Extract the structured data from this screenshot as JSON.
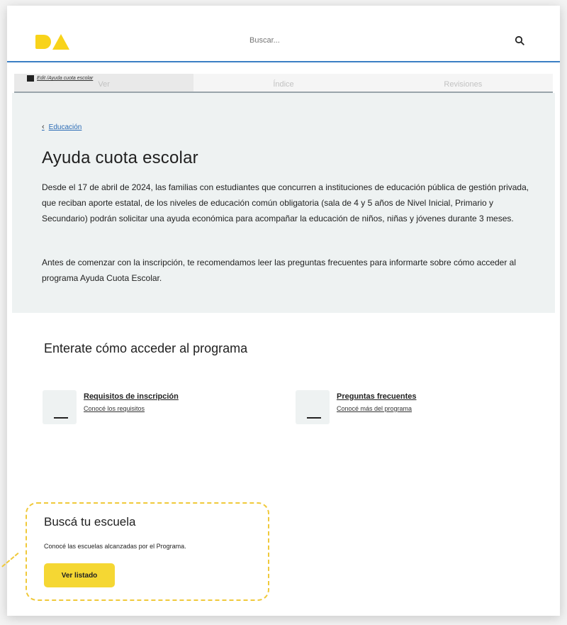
{
  "header": {
    "logo_text": "BA",
    "search": {
      "placeholder": "Buscar...",
      "icon": "search-icon"
    }
  },
  "edit_label": "Edit /Ayuda cuota escolar",
  "tabs": [
    {
      "label": "Ver",
      "active": true
    },
    {
      "label": "Índice",
      "active": false
    },
    {
      "label": "Revisiones",
      "active": false
    }
  ],
  "breadcrumb": {
    "back_icon": "chevron-left-icon",
    "label": "Educación"
  },
  "hero": {
    "title": "Ayuda cuota escolar",
    "paragraph1": "Desde el 17 de abril de 2024, las familias con estudiantes que concurren a instituciones de educación pública de gestión privada, que reciban aporte estatal, de los niveles de educación común obligatoria (sala de 4 y 5 años de Nivel Inicial, Primario y Secundario) podrán solicitar una ayuda económica para acompañar la educación de niños, niñas y jóvenes durante 3 meses.",
    "paragraph2": "Antes de comenzar con la inscripción, te recomendamos leer las preguntas frecuentes para informarte sobre cómo acceder al programa Ayuda Cuota Escolar."
  },
  "section": {
    "title": "Enterate cómo acceder al programa",
    "cards": [
      {
        "title": "Requisitos de inscripción",
        "subtitle": "Conocé los requisitos"
      },
      {
        "title": "Preguntas frecuentes",
        "subtitle": "Conocé más del programa"
      }
    ]
  },
  "callout": {
    "title": "Buscá tu escuela",
    "description": "Conocé las escuelas alcanzadas por el Programa.",
    "button_label": "Ver listado"
  },
  "colors": {
    "brand_yellow": "#f8d31a",
    "header_border": "#3b7fc4",
    "hero_bg": "#eef2f2",
    "link": "#2a6bb5",
    "callout_border": "#f0c93a"
  }
}
